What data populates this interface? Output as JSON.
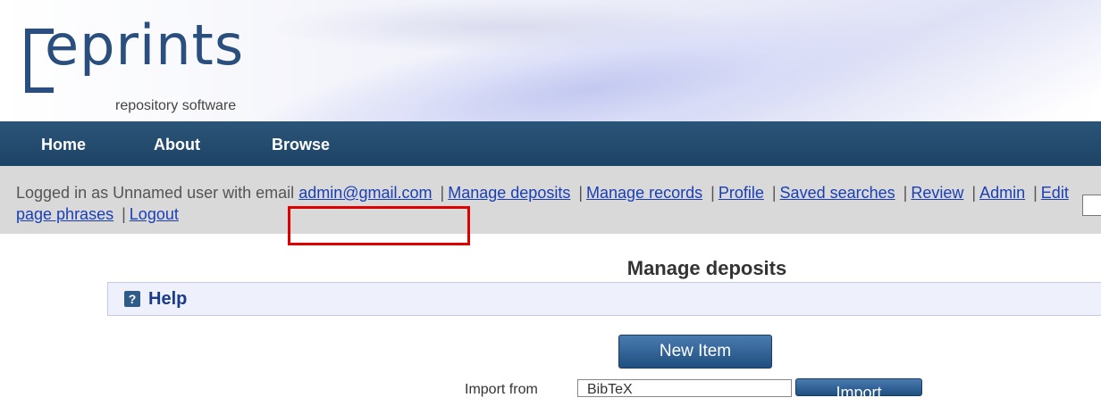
{
  "logo": {
    "text": "eprints",
    "subtitle": "repository software"
  },
  "nav": {
    "items": [
      {
        "label": "Home"
      },
      {
        "label": "About"
      },
      {
        "label": "Browse"
      }
    ]
  },
  "userbar": {
    "prefix": "Logged in as Unnamed user with email",
    "email": "admin@gmail.com",
    "links": [
      "Manage deposits",
      "Manage records",
      "Profile",
      "Saved searches",
      "Review",
      "Admin",
      "Edit page phrases",
      "Logout"
    ]
  },
  "main": {
    "title": "Manage deposits",
    "help_label": "Help",
    "help_icon": "?",
    "new_item_label": "New Item",
    "import_label": "Import from",
    "import_selected": "BibTeX",
    "import_button": "Import"
  },
  "colors": {
    "nav_bg": "#2a5478",
    "link": "#1a3fb5",
    "highlight": "#e00000",
    "button": "#2f5b8a"
  }
}
